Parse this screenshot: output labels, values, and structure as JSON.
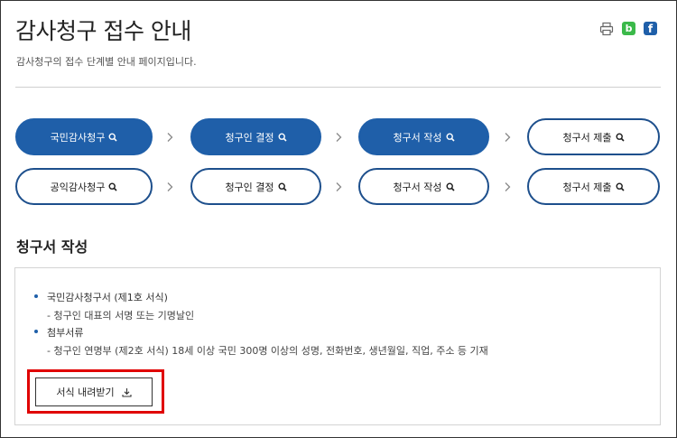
{
  "page": {
    "title": "감사청구 접수 안내",
    "subtitle": "감사청구의 접수 단계별 안내 페이지입니다."
  },
  "share": {
    "band_label": "b",
    "facebook_label": "f"
  },
  "steps": {
    "row1": [
      {
        "label": "국민감사청구",
        "style": "filled"
      },
      {
        "label": "청구인 결정",
        "style": "filled"
      },
      {
        "label": "청구서 작성",
        "style": "filled"
      },
      {
        "label": "청구서 제출",
        "style": "outline"
      }
    ],
    "row2": [
      {
        "label": "공익감사청구",
        "style": "outline"
      },
      {
        "label": "청구인 결정",
        "style": "outline"
      },
      {
        "label": "청구서 작성",
        "style": "outline"
      },
      {
        "label": "청구서 제출",
        "style": "outline"
      }
    ]
  },
  "section": {
    "title": "청구서 작성",
    "items": [
      {
        "heading": "국민감사청구서 (제1호 서식)",
        "detail": "- 청구인 대표의 서명 또는 기명날인"
      },
      {
        "heading": "첨부서류",
        "detail": "- 청구인 연명부 (제2호 서식) 18세 이상 국민 300명 이상의 성명, 전화번호, 생년월일, 직업, 주소 등 기재"
      }
    ],
    "download_label": "서식 내려받기"
  },
  "colors": {
    "primary": "#1f5fa9",
    "highlight": "#e00000",
    "band_green": "#3bb94a"
  }
}
